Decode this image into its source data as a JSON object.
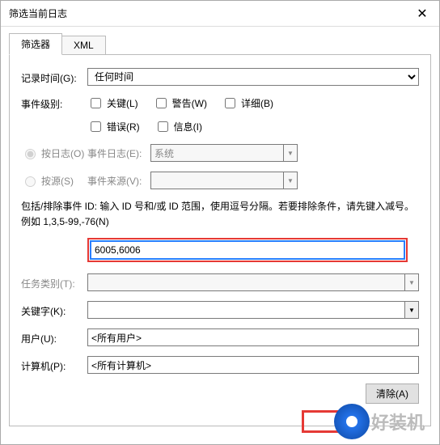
{
  "window": {
    "title": "筛选当前日志"
  },
  "tabs": {
    "filter": "筛选器",
    "xml": "XML"
  },
  "labels": {
    "logged_time": "记录时间(G):",
    "event_level": "事件级别:",
    "event_log": "事件日志(E):",
    "event_source": "事件来源(V):",
    "task_category": "任务类别(T):",
    "keywords": "关键字(K):",
    "user": "用户(U):",
    "computer": "计算机(P):"
  },
  "logged_time": {
    "value": "任何时间"
  },
  "levels": {
    "critical": "关键(L)",
    "warning": "警告(W)",
    "verbose": "详细(B)",
    "error": "错误(R)",
    "info": "信息(I)"
  },
  "radio": {
    "by_log": "按日志(O)",
    "by_source": "按源(S)"
  },
  "event_log": {
    "value": "系统"
  },
  "event_source": {
    "value": ""
  },
  "help_text": "包括/排除事件 ID: 输入 ID 号和/或 ID 范围，使用逗号分隔。若要排除条件，请先键入减号。例如 1,3,5-99,-76(N)",
  "event_ids": {
    "value": "6005,6006"
  },
  "task_category": {
    "value": ""
  },
  "keywords": {
    "value": ""
  },
  "user": {
    "value": "<所有用户>"
  },
  "computer": {
    "value": "<所有计算机>"
  },
  "buttons": {
    "clear": "清除(A)"
  },
  "brand": "好装机"
}
